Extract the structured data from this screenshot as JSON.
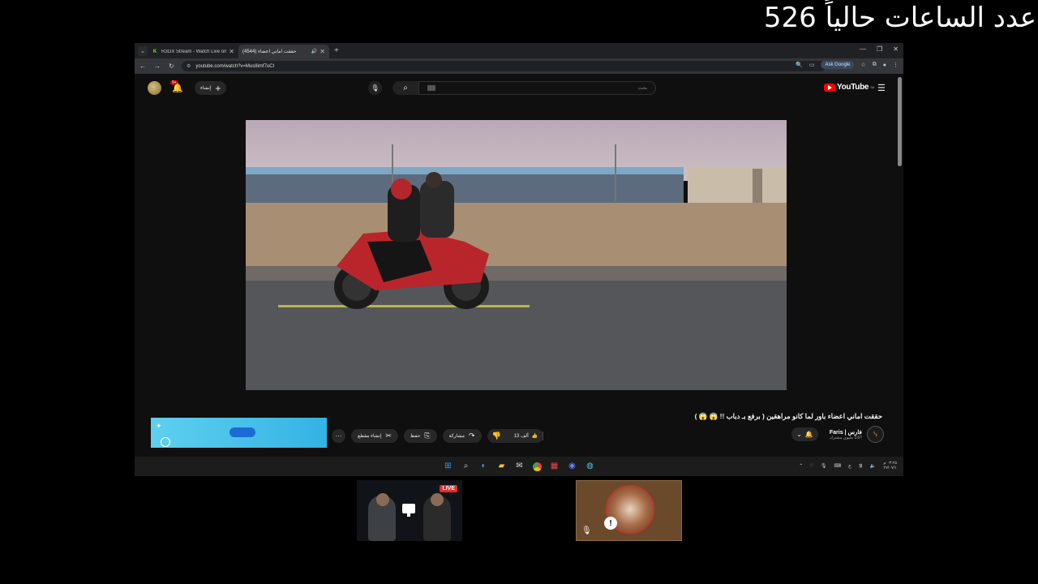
{
  "overlay": {
    "hours_counter": "عدد الساعات حالياً 526"
  },
  "browser": {
    "tabs": [
      {
        "title": "R3OX Stream - Watch Live on K",
        "favicon": "kick-icon",
        "active": false
      },
      {
        "title": "حققت اماني اعضاء (4544)",
        "favicon": "youtube-icon",
        "active": true
      }
    ],
    "url": "youtube.com/watch?v=Mus8imf7uCI",
    "ask_google": "Ask Google"
  },
  "youtube": {
    "create_label": "إنشاء",
    "notification_count": "9+",
    "search_placeholder": "بحث",
    "logo_text": "YouTube",
    "logo_region": "SA",
    "video_title": "حققت اماني اعضاء باور لما كانو مراهقين ( برفع بـ دباب !! 😱 😱 )",
    "channel": {
      "name": "فارس | Faris",
      "subscribers": "3.67 مليون مشترك"
    },
    "actions": {
      "likes": "13 ألف",
      "share": "مشاركة",
      "save": "حفظ",
      "clip": "إنشاء مقطع"
    }
  },
  "taskbar": {
    "clock_time": "٠٣:٢٥ م",
    "clock_date": "٢٧/٠٧/١",
    "lang": "ع"
  },
  "stream": {
    "live_label": "LIVE"
  },
  "colors": {
    "youtube_red": "#ff0000",
    "live_red": "#e52b2b",
    "ad_blue": "#33b3e4"
  }
}
